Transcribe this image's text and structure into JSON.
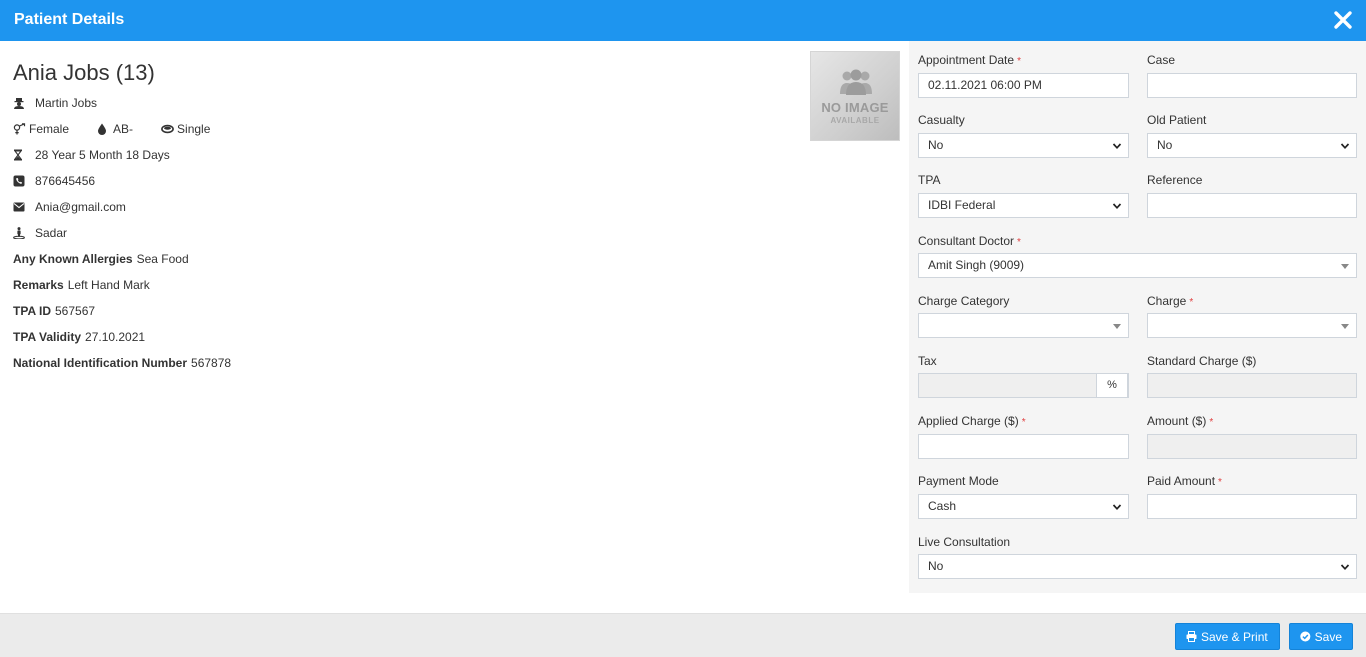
{
  "header": {
    "title": "Patient Details"
  },
  "patient": {
    "name": "Ania Jobs (13)",
    "guardian": "Martin Jobs",
    "gender": "Female",
    "blood_group": "AB-",
    "marital_status": "Single",
    "age": "28 Year 5 Month 18 Days",
    "phone": "876645456",
    "email": "Ania@gmail.com",
    "address": "Sadar",
    "allergies_label": "Any Known Allergies",
    "allergies": "Sea Food",
    "remarks_label": "Remarks",
    "remarks": "Left Hand Mark",
    "tpa_id_label": "TPA ID",
    "tpa_id": "567567",
    "tpa_validity_label": "TPA Validity",
    "tpa_validity": "27.10.2021",
    "nin_label": "National Identification Number",
    "nin": "567878",
    "photo_main": "NO IMAGE",
    "photo_sub": "AVAILABLE"
  },
  "form": {
    "appointment_date": {
      "label": "Appointment Date",
      "value": "02.11.2021 06:00 PM",
      "required": "*"
    },
    "case": {
      "label": "Case",
      "value": ""
    },
    "casualty": {
      "label": "Casualty",
      "value": "No"
    },
    "old_patient": {
      "label": "Old Patient",
      "value": "No"
    },
    "tpa": {
      "label": "TPA",
      "value": "IDBI Federal"
    },
    "reference": {
      "label": "Reference",
      "value": ""
    },
    "consultant_doctor": {
      "label": "Consultant Doctor",
      "value": "Amit Singh (9009)",
      "required": "*"
    },
    "charge_category": {
      "label": "Charge Category",
      "value": ""
    },
    "charge": {
      "label": "Charge",
      "value": "",
      "required": "*"
    },
    "tax": {
      "label": "Tax",
      "value": "",
      "suffix": "%"
    },
    "standard_charge": {
      "label": "Standard Charge ($)",
      "value": ""
    },
    "applied_charge": {
      "label": "Applied Charge ($)",
      "value": "",
      "required": "*"
    },
    "amount": {
      "label": "Amount ($)",
      "value": "",
      "required": "*"
    },
    "payment_mode": {
      "label": "Payment Mode",
      "value": "Cash"
    },
    "paid_amount": {
      "label": "Paid Amount",
      "value": "",
      "required": "*"
    },
    "live_consultation": {
      "label": "Live Consultation",
      "value": "No"
    }
  },
  "footer": {
    "save_print_label": "Save & Print",
    "save_label": "Save"
  },
  "colors": {
    "primary": "#1e95ef",
    "panel_bg": "#f5f5f5",
    "footer_bg": "#ebebeb",
    "required": "#e04040"
  }
}
